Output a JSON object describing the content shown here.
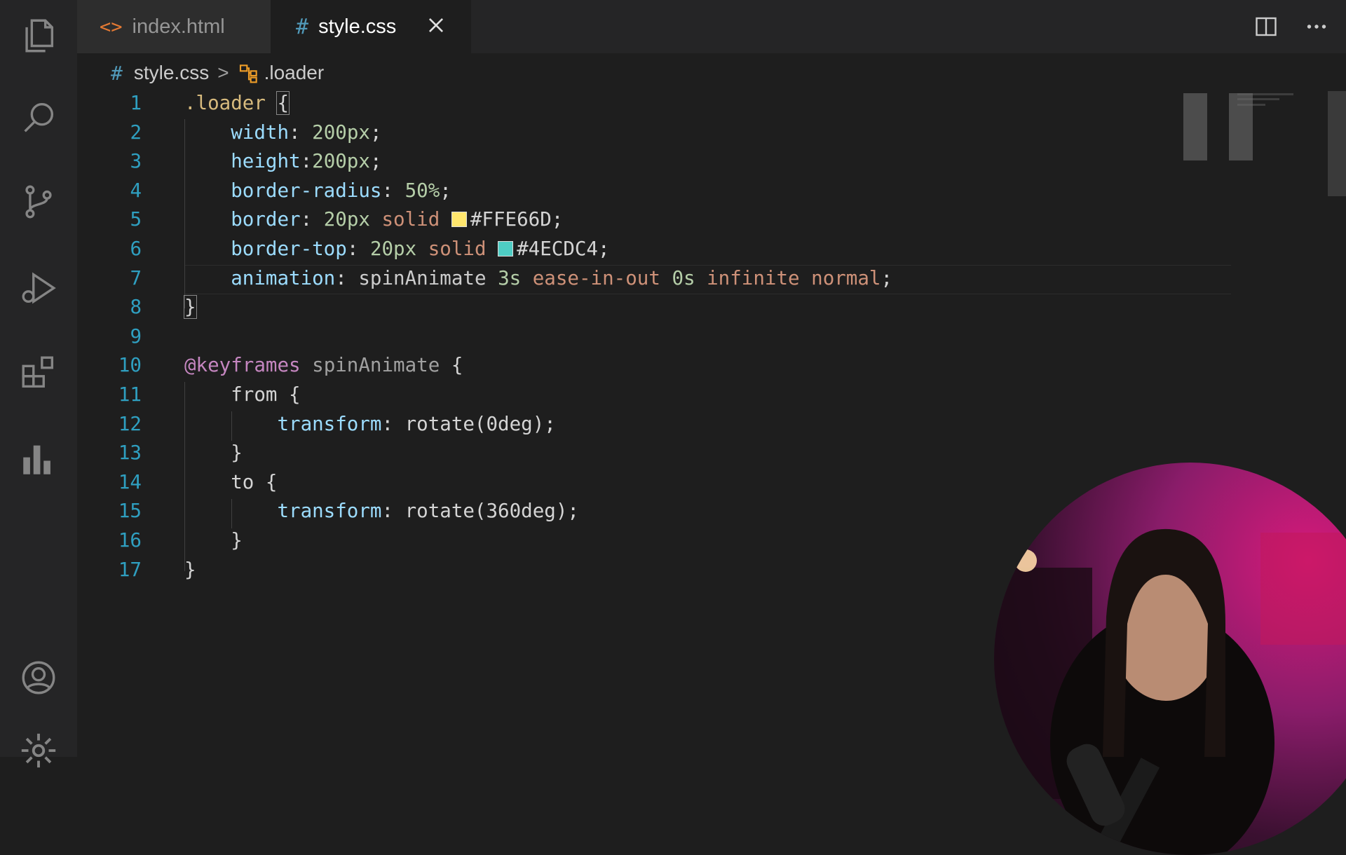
{
  "tabs": [
    {
      "label": "index.html",
      "icon": "<>",
      "active": false
    },
    {
      "label": "style.css",
      "icon": "#",
      "active": true
    }
  ],
  "breadcrumb": {
    "file": "style.css",
    "symbol": ".loader"
  },
  "code": {
    "line_numbers": [
      "1",
      "2",
      "3",
      "4",
      "5",
      "6",
      "7",
      "8",
      "9",
      "10",
      "11",
      "12",
      "13",
      "14",
      "15",
      "16",
      "17"
    ],
    "l1_selector": ".loader",
    "l2": {
      "prop": "width",
      "val": "200px"
    },
    "l3": {
      "prop": "height",
      "val": "200px"
    },
    "l4": {
      "prop": "border-radius",
      "val": "50%"
    },
    "l5": {
      "prop": "border",
      "size": "20px",
      "style": "solid",
      "color": "#FFE66D"
    },
    "l6": {
      "prop": "border-top",
      "size": "20px",
      "style": "solid",
      "color": "#4ECDC4"
    },
    "l7": {
      "prop": "animation",
      "name": "spinAnimate",
      "dur": "3s",
      "timing": "ease-in-out",
      "delay": "0s",
      "iter": "infinite",
      "dir": "normal"
    },
    "l10": {
      "at": "@keyframes",
      "name": "spinAnimate"
    },
    "l11": "from",
    "l12": {
      "prop": "transform",
      "val": "rotate(0deg)"
    },
    "l14": "to",
    "l15": {
      "prop": "transform",
      "val": "rotate(360deg)"
    }
  },
  "colors": {
    "swatch_yellow": "#FFE66D",
    "swatch_teal": "#4ECDC4"
  },
  "icons": {
    "activity_bar": [
      "files-icon",
      "search-icon",
      "source-control-icon",
      "run-debug-icon",
      "extensions-icon",
      "chart-icon",
      "account-icon",
      "settings-gear-icon"
    ],
    "editor_actions": [
      "split-editor-icon",
      "more-actions-icon"
    ]
  }
}
